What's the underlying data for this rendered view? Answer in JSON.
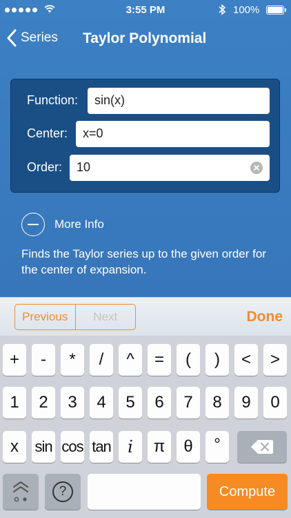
{
  "status": {
    "time": "3:55 PM",
    "battery": "100%"
  },
  "nav": {
    "back_label": "Series",
    "title": "Taylor Polynomial"
  },
  "form": {
    "function": {
      "label": "Function:",
      "value": "sin(x)"
    },
    "center": {
      "label": "Center:",
      "value": "x=0"
    },
    "order": {
      "label": "Order:",
      "value": "10"
    }
  },
  "more_info": {
    "label": "More Info"
  },
  "description": "Finds the Taylor series up to the given order for the center of expansion.",
  "toolbar": {
    "previous": "Previous",
    "next": "Next",
    "done": "Done"
  },
  "keyboard": {
    "row1": [
      "+",
      "-",
      "*",
      "/",
      "^",
      "=",
      "(",
      ")",
      "<",
      ">"
    ],
    "row2": [
      "1",
      "2",
      "3",
      "4",
      "5",
      "6",
      "7",
      "8",
      "9",
      "0"
    ],
    "row3": [
      "x",
      "sin",
      "cos",
      "tan",
      "i",
      "π",
      "θ",
      "°"
    ],
    "compute": "Compute",
    "help": "?"
  },
  "colors": {
    "accent": "#f08c2e",
    "background": "#3a7cc0",
    "panel": "#1a4f85"
  }
}
